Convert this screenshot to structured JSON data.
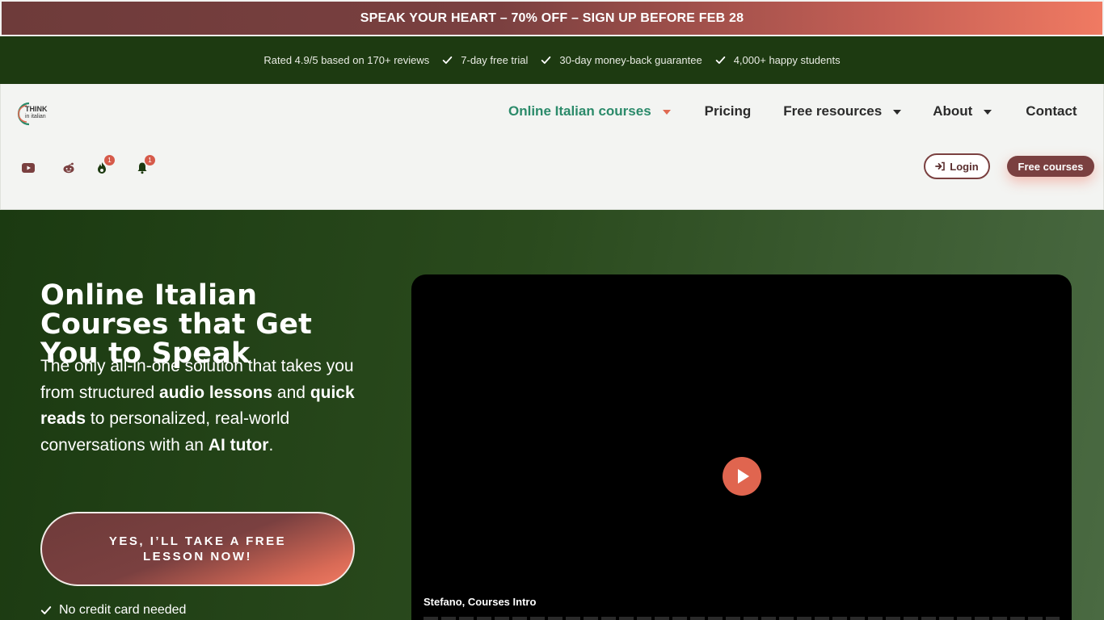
{
  "promo": {
    "text": "SPEAK YOUR HEART – 70% OFF – SIGN UP BEFORE FEB 28"
  },
  "trust": {
    "items": [
      {
        "text": "Rated 4.9/5 based on 170+ reviews",
        "check": false
      },
      {
        "text": "7-day free trial",
        "check": true
      },
      {
        "text": "30-day money-back guarantee",
        "check": true
      },
      {
        "text": "4,000+ happy students",
        "check": true
      }
    ]
  },
  "logo": {
    "line1": "THINK",
    "line2": "in italian"
  },
  "nav": {
    "items": [
      {
        "label": "Online Italian courses",
        "dropdown": true,
        "active": true
      },
      {
        "label": "Pricing",
        "dropdown": false
      },
      {
        "label": "Free resources",
        "dropdown": true
      },
      {
        "label": "About",
        "dropdown": true
      },
      {
        "label": "Contact",
        "dropdown": false
      }
    ]
  },
  "social": {
    "youtube_icon": "youtube-icon",
    "reddit_icon": "reddit-icon",
    "fire_badge": "1",
    "bell_badge": "1"
  },
  "header_buttons": {
    "login": "Login",
    "free_courses": "Free courses"
  },
  "hero": {
    "title": "Online Italian Courses that Get You to Speak",
    "sub_1": "The only all-in-one solution that takes you from structured ",
    "sub_b1": "audio lessons",
    "sub_2": " and ",
    "sub_b2": "quick reads",
    "sub_3": " to personalized, real-world conversations with an ",
    "sub_b3": "AI tutor",
    "sub_4": ".",
    "cta": "YES, I’LL TAKE A FREE LESSON NOW!",
    "no_cc": "No credit card needed"
  },
  "video": {
    "caption": "Stefano, Courses Intro"
  },
  "colors": {
    "accent": "#e06a52",
    "brand_dark": "#7a4040",
    "green_active": "#2b8a6a",
    "hero_green": "#1b3a11"
  }
}
